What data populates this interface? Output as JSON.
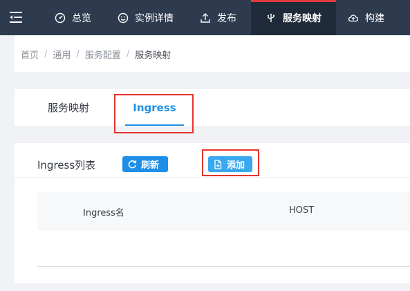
{
  "nav": {
    "items": [
      {
        "label": "总览",
        "icon": "dashboard-icon"
      },
      {
        "label": "实例详情",
        "icon": "smiley-icon"
      },
      {
        "label": "发布",
        "icon": "upload-icon"
      },
      {
        "label": "服务映射",
        "icon": "usb-icon",
        "active": true
      },
      {
        "label": "构建",
        "icon": "cloud-icon"
      }
    ],
    "background": "#2e3b4e",
    "active_background": "#1f2a3a",
    "active_accent": "#e03a3e"
  },
  "breadcrumb": {
    "items": [
      "首页",
      "通用",
      "服务配置",
      "服务映射"
    ],
    "separator": "/"
  },
  "tabs": {
    "items": [
      {
        "label": "服务映射",
        "active": false
      },
      {
        "label": "Ingress",
        "active": true
      }
    ],
    "active_color": "#1e90e6"
  },
  "list": {
    "title": "Ingress列表",
    "refresh_label": "刷新",
    "add_label": "添加",
    "columns": [
      "Ingress名",
      "HOST"
    ],
    "rows": []
  },
  "highlight_color": "#e5332a"
}
